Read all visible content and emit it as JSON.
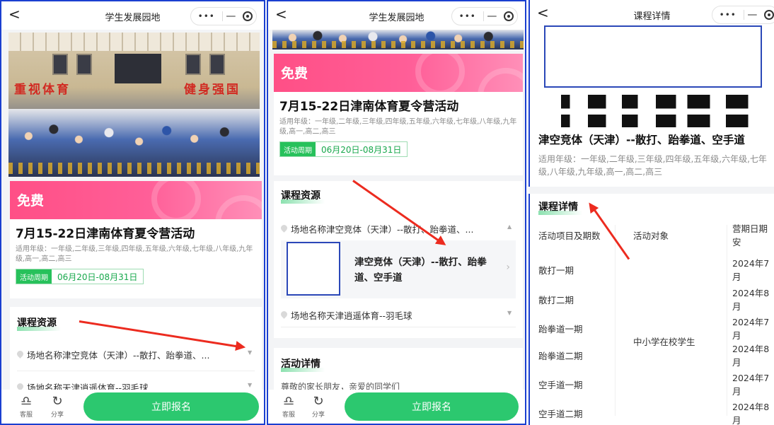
{
  "common": {
    "back_glyph": "<",
    "capsule_dots": "•••",
    "capsule_min": "—"
  },
  "panel1": {
    "nav_title": "学生发展园地",
    "photo_slogan_left": "重视体育",
    "photo_slogan_right": "健身强国",
    "price": "免费",
    "event_title": "7月15-22日津南体育夏令营活动",
    "grades": "适用年级：一年级,二年级,三年级,四年级,五年级,六年级,七年级,八年级,九年级,高一,高二,高三",
    "period_tag": "活动周期",
    "period_range": "06月20日-08月31日",
    "section_title": "课程资源",
    "venues": [
      "场地名称津空竞体（天津）--散打、跆拳道、...",
      "场地名称天津逍遥体育--羽毛球"
    ],
    "toolbar": {
      "service": "客服",
      "share": "分享",
      "signup": "立即报名"
    }
  },
  "panel2": {
    "nav_title": "学生发展园地",
    "price": "免费",
    "event_title": "7月15-22日津南体育夏令营活动",
    "grades": "适用年级：一年级,二年级,三年级,四年级,五年级,六年级,七年级,八年级,九年级,高一,高二,高三",
    "period_tag": "活动周期",
    "period_range": "06月20日-08月31日",
    "section_title": "课程资源",
    "venue_expanded": "场地名称津空竞体（天津）--散打、跆拳道、...",
    "course_name": "津空竞体（天津）--散打、跆拳道、空手道",
    "venue_collapsed": "场地名称天津逍遥体育--羽毛球",
    "detail_title": "活动详情",
    "detail_preview": "尊敬的家长朋友，亲爱的同学们",
    "toolbar": {
      "service": "客服",
      "share": "分享",
      "signup": "立即报名"
    }
  },
  "panel3": {
    "nav_title": "课程详情",
    "course_name": "津空竞体（天津）--散打、跆拳道、空手道",
    "grades": "适用年级：一年级,二年级,三年级,四年级,五年级,六年级,七年级,八年级,九年级,高一,高二,高三",
    "section_title": "课程详情",
    "table": {
      "headers": [
        "活动项目及期数",
        "活动对象",
        "营期日期安"
      ],
      "target": "中小学在校学生",
      "rows": [
        {
          "item": "散打一期",
          "date": "2024年7月"
        },
        {
          "item": "散打二期",
          "date": "2024年8月"
        },
        {
          "item": "跆拳道一期",
          "date": "2024年7月"
        },
        {
          "item": "跆拳道二期",
          "date": "2024年8月"
        },
        {
          "item": "空手道一期",
          "date": "2024年7月"
        },
        {
          "item": "空手道二期",
          "date": "2024年8月"
        }
      ]
    }
  },
  "colors": {
    "accent_green": "#2cc86f",
    "banner_pink": "#ff4f86",
    "annotation_red": "#ec2b1f",
    "frame_blue": "#1a3fd0"
  },
  "icons": [
    "back-icon",
    "more-icon",
    "minimize-icon",
    "record-icon",
    "pin-icon",
    "service-icon",
    "share-icon",
    "chevron-right-icon",
    "triangle-down-icon",
    "triangle-up-icon"
  ]
}
